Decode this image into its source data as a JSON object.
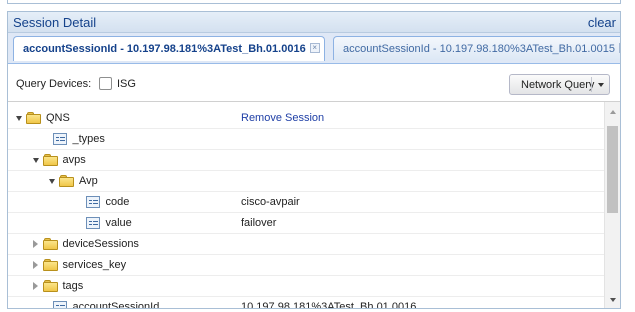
{
  "panel": {
    "title": "Session Detail",
    "clear_label": "clear"
  },
  "tabs": [
    {
      "label": "accountSessionId - 10.197.98.181%3ATest_Bh.01.0016",
      "active": true
    },
    {
      "label": "accountSessionId - 10.197.98.180%3ATest_Bh.01.0015",
      "active": false
    }
  ],
  "toolbar": {
    "query_devices_label": "Query Devices:",
    "isg_label": "ISG",
    "isg_checked": false,
    "network_query_label": "Network Query"
  },
  "tree": [
    {
      "label": "QNS",
      "value": "Remove Session",
      "type": "folder",
      "level": 0,
      "state": "expanded"
    },
    {
      "label": "_types",
      "value": "",
      "type": "leaf",
      "level": 1,
      "state": "none"
    },
    {
      "label": "avps",
      "value": "",
      "type": "folder",
      "level": 1,
      "state": "expanded"
    },
    {
      "label": "Avp",
      "value": "",
      "type": "folder",
      "level": 2,
      "state": "expanded"
    },
    {
      "label": "code",
      "value": "cisco-avpair",
      "type": "leaf",
      "level": 3,
      "state": "none"
    },
    {
      "label": "value",
      "value": "failover",
      "type": "leaf",
      "level": 3,
      "state": "none"
    },
    {
      "label": "deviceSessions",
      "value": "",
      "type": "folder",
      "level": 1,
      "state": "collapsed"
    },
    {
      "label": "services_key",
      "value": "",
      "type": "folder",
      "level": 1,
      "state": "collapsed"
    },
    {
      "label": "tags",
      "value": "",
      "type": "folder",
      "level": 1,
      "state": "collapsed"
    },
    {
      "label": "accountSessionId",
      "value": "10.197.98.181%3ATest_Bh.01.0016",
      "type": "leaf",
      "level": 1,
      "state": "none"
    }
  ],
  "icons": {
    "folder": "folder-icon",
    "leaf": "property-icon",
    "tab_close": "close-icon",
    "dropdown": "chevron-down-icon",
    "expanded": "triangle-down-icon",
    "collapsed": "triangle-right-icon"
  },
  "colors": {
    "header_text": "#15428b",
    "link": "#1f3fa6",
    "folder": "#f0c649"
  }
}
